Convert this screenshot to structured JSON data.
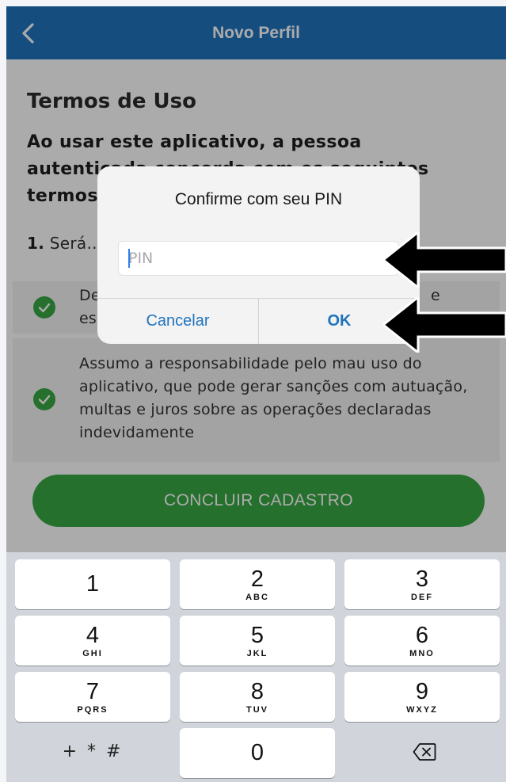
{
  "header": {
    "title": "Novo Perfil"
  },
  "terms": {
    "title": "Termos de Uso",
    "intro": "Ao usar este aplicativo, a pessoa autenticada concorda com os seguintes termos",
    "item1_number": "1.",
    "item1_text": "Será... no Cadastro"
  },
  "agreements": [
    {
      "text_start": "De",
      "text_end": "e",
      "text_line2": "es",
      "checked": true
    },
    {
      "text": "Assumo a responsabilidade pelo mau uso do aplicativo, que pode gerar sanções com autuação, multas e juros sobre as operações declaradas indevidamente",
      "checked": true
    }
  ],
  "conclude_button": "CONCLUIR CADASTRO",
  "dialog": {
    "title": "Confirme com seu PIN",
    "pin_placeholder": "PIN",
    "pin_value": "",
    "cancel_label": "Cancelar",
    "ok_label": "OK"
  },
  "keyboard": {
    "keys": [
      {
        "digit": "1",
        "letters": ""
      },
      {
        "digit": "2",
        "letters": "ABC"
      },
      {
        "digit": "3",
        "letters": "DEF"
      },
      {
        "digit": "4",
        "letters": "GHI"
      },
      {
        "digit": "5",
        "letters": "JKL"
      },
      {
        "digit": "6",
        "letters": "MNO"
      },
      {
        "digit": "7",
        "letters": "PQRS"
      },
      {
        "digit": "8",
        "letters": "TUV"
      },
      {
        "digit": "9",
        "letters": "WXYZ"
      },
      {
        "symbol": "+ * #"
      },
      {
        "digit": "0"
      },
      {
        "icon": "backspace-icon"
      }
    ]
  },
  "colors": {
    "header": "#1f73bd",
    "accent_green": "#3aa843",
    "dialog_button": "#1f73bd",
    "arrow": "#000000"
  }
}
